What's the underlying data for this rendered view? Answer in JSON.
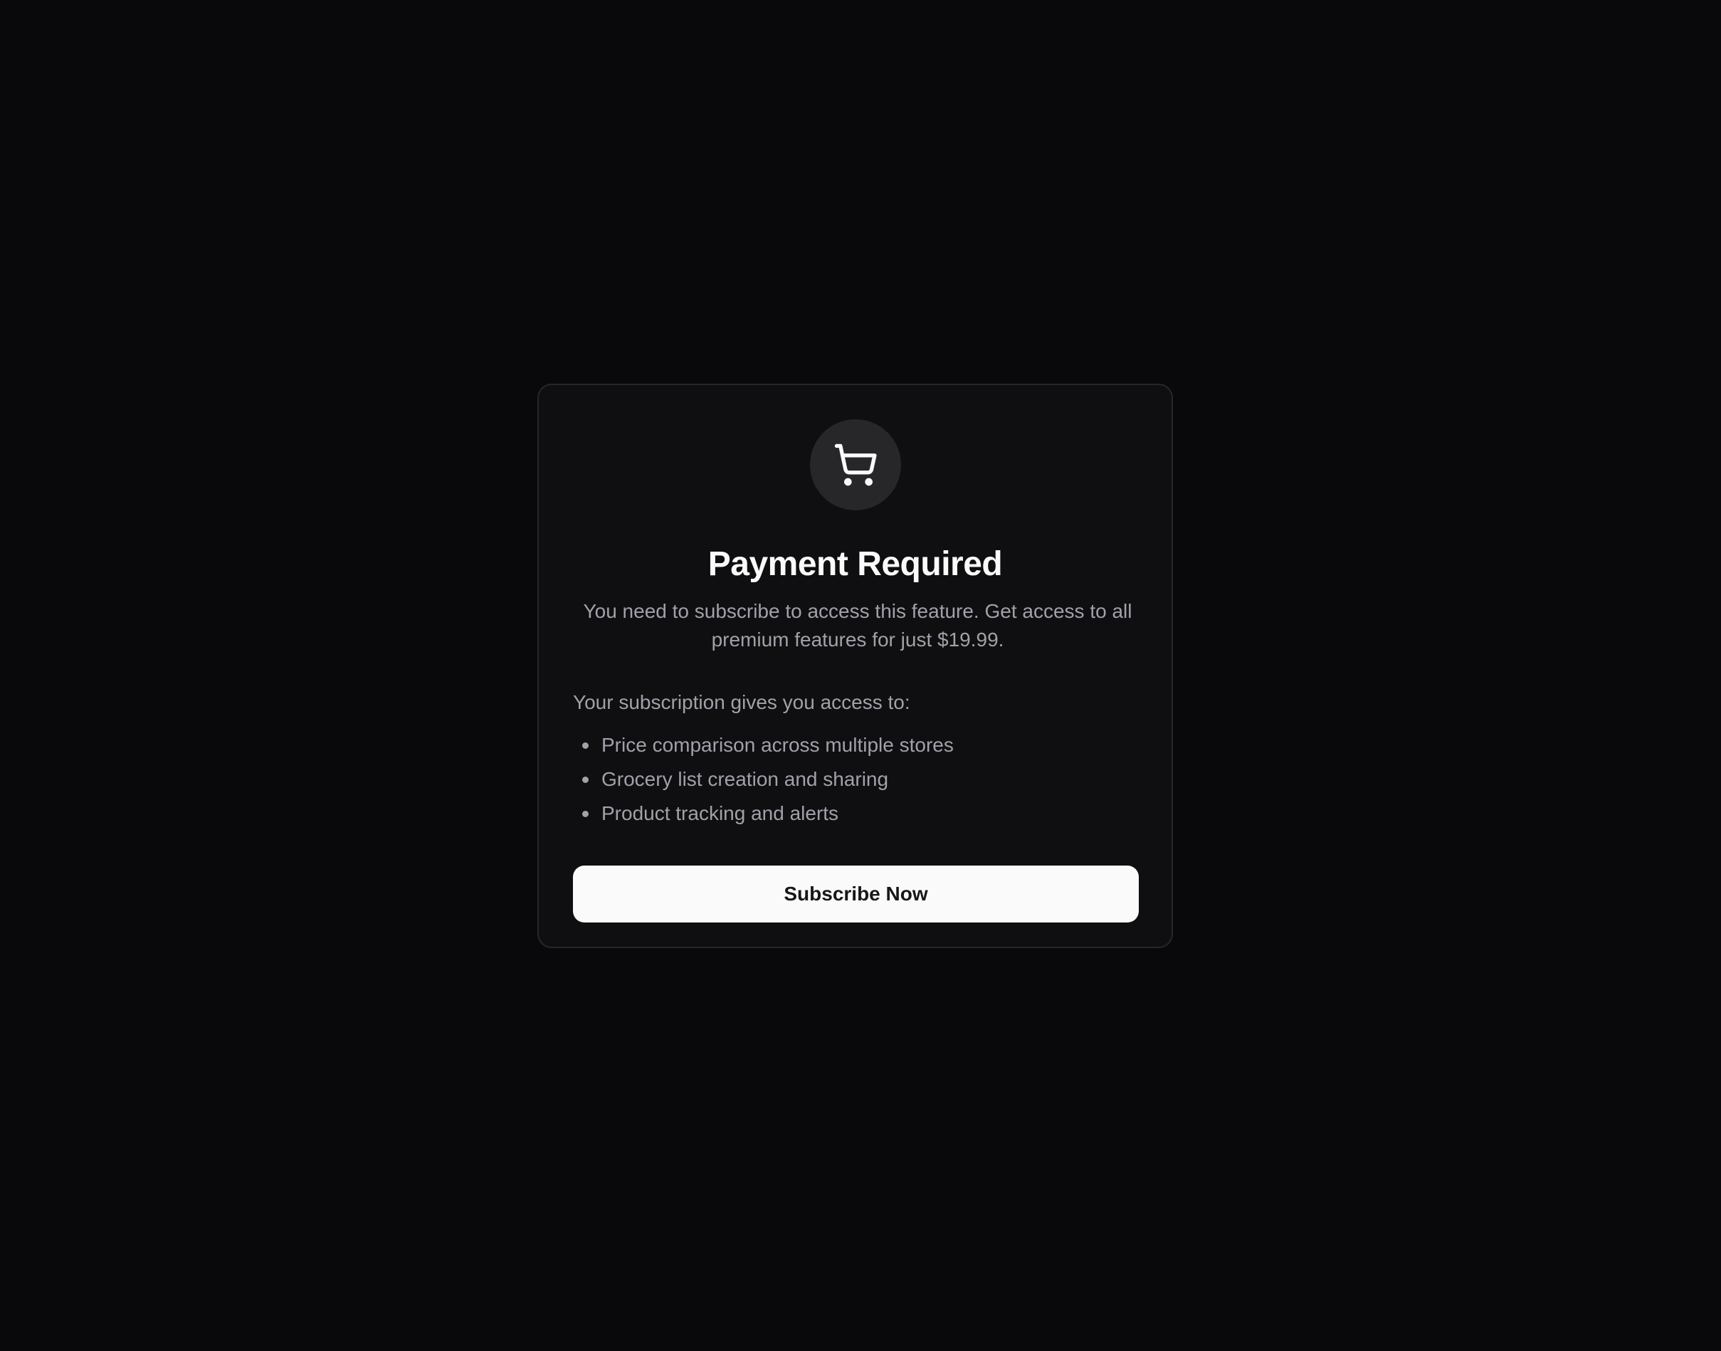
{
  "paywall": {
    "icon": "shopping-cart-icon",
    "title": "Payment Required",
    "description": "You need to subscribe to access this feature. Get access to all premium features for just $19.99.",
    "benefits_heading": "Your subscription gives you access to:",
    "benefits": [
      "Price comparison across multiple stores",
      "Grocery list creation and sharing",
      "Product tracking and alerts"
    ],
    "cta_label": "Subscribe Now"
  },
  "colors": {
    "background": "#09090b",
    "card": "#0f0f11",
    "card_border": "#27272a",
    "icon_bg": "#27272a",
    "title": "#fafafa",
    "muted_text": "#a1a1aa",
    "button_bg": "#fafafa",
    "button_text": "#18181b"
  }
}
